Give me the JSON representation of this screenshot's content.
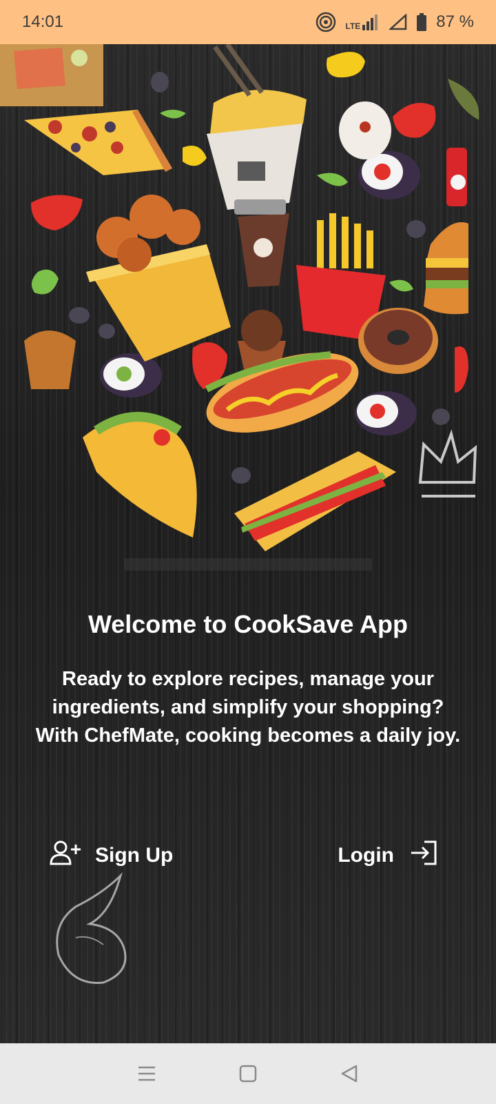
{
  "status_bar": {
    "time": "14:01",
    "network_label": "LTE",
    "battery": "87 %",
    "icons": [
      "hotspot-icon",
      "lte-signal-icon",
      "wifi-signal-icon",
      "battery-icon"
    ]
  },
  "main": {
    "title": "Welcome to CookSave App",
    "description": "Ready to explore recipes, manage your ingredients, and simplify your shopping? With ChefMate, cooking becomes a daily joy.",
    "sign_up_label": "Sign Up",
    "login_label": "Login",
    "sign_up_icon": "add-user-icon",
    "login_icon": "login-arrow-icon"
  },
  "nav_bar": {
    "icons": [
      "menu-icon",
      "home-icon",
      "back-icon"
    ]
  },
  "colors": {
    "status_bar_bg": "#FFC183",
    "background": "#242424",
    "text": "#FFFFFF",
    "nav_bar_bg": "#E9E9E9"
  }
}
